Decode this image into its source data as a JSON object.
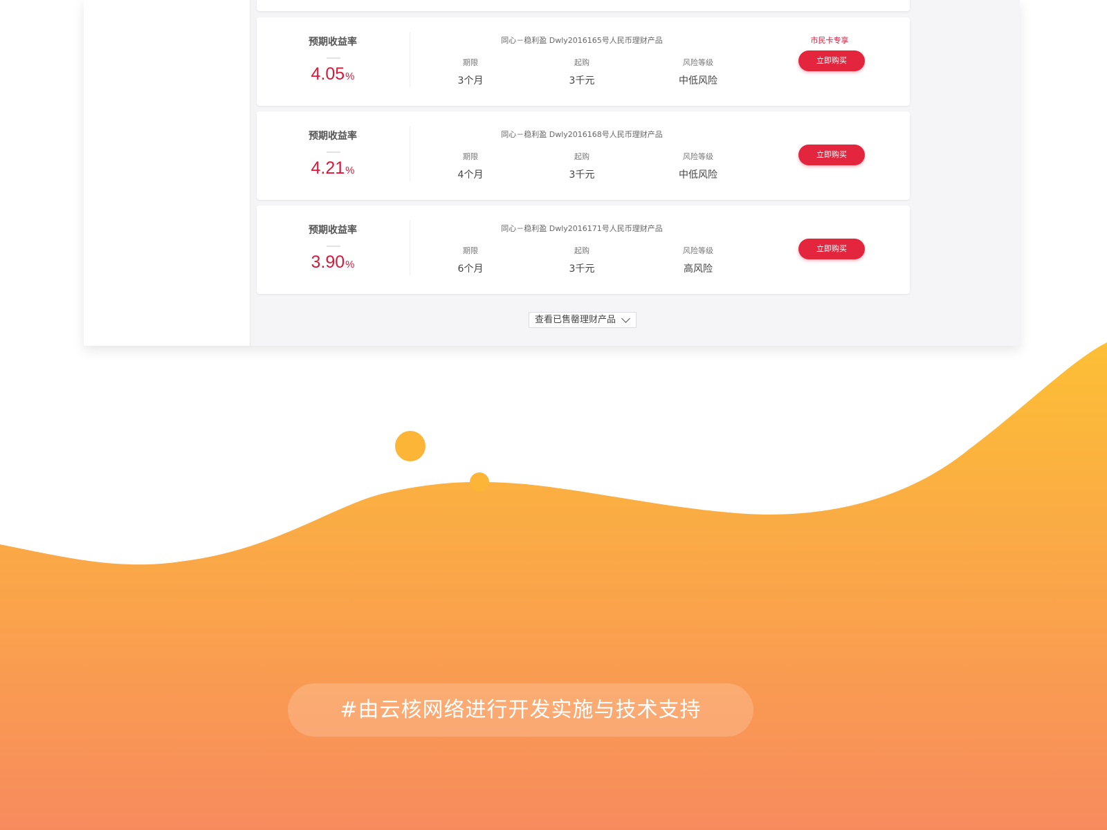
{
  "colors": {
    "accent_red": "#e3263e",
    "rate_red": "#d7193a",
    "wave_top": "#fcbf35",
    "wave_bottom": "#f88b5e"
  },
  "products": [
    {
      "rate_label": "预期收益率",
      "rate_value": "4.05",
      "rate_unit": "%",
      "name": "同心－稳利盈 Dwly2016165号人民币理财产品",
      "term_label": "期限",
      "term_value": "3个月",
      "min_label": "起购",
      "min_value": "3千元",
      "risk_label": "风险等级",
      "risk_value": "中低风险",
      "tag": "市民卡专享",
      "button": "立即购买"
    },
    {
      "rate_label": "预期收益率",
      "rate_value": "4.21",
      "rate_unit": "%",
      "name": "同心－稳利盈 Dwly2016168号人民币理财产品",
      "term_label": "期限",
      "term_value": "4个月",
      "min_label": "起购",
      "min_value": "3千元",
      "risk_label": "风险等级",
      "risk_value": "中低风险",
      "tag": "",
      "button": "立即购买"
    },
    {
      "rate_label": "预期收益率",
      "rate_value": "3.90",
      "rate_unit": "%",
      "name": "同心－稳利盈 Dwly2016171号人民币理财产品",
      "term_label": "期限",
      "term_value": "6个月",
      "min_label": "起购",
      "min_value": "3千元",
      "risk_label": "风险等级",
      "risk_value": "高风险",
      "tag": "",
      "button": "立即购买"
    }
  ],
  "view_sold": {
    "label": "查看已售罄理财产品",
    "icon": "chevron-down-icon"
  },
  "footer": {
    "text": "#由云核网络进行开发实施与技术支持"
  }
}
